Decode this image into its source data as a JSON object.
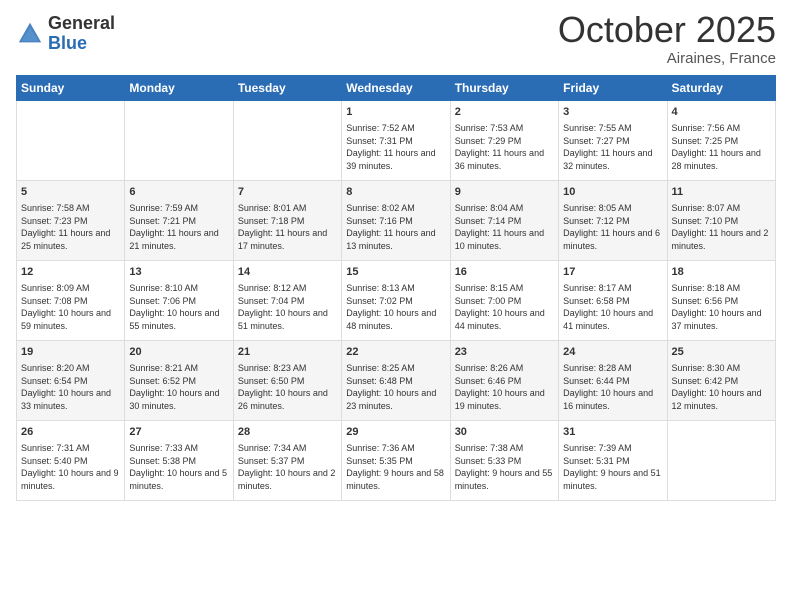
{
  "header": {
    "logo_general": "General",
    "logo_blue": "Blue",
    "month": "October 2025",
    "location": "Airaines, France"
  },
  "days_of_week": [
    "Sunday",
    "Monday",
    "Tuesday",
    "Wednesday",
    "Thursday",
    "Friday",
    "Saturday"
  ],
  "weeks": [
    [
      {
        "day": "",
        "info": ""
      },
      {
        "day": "",
        "info": ""
      },
      {
        "day": "",
        "info": ""
      },
      {
        "day": "1",
        "info": "Sunrise: 7:52 AM\nSunset: 7:31 PM\nDaylight: 11 hours and 39 minutes."
      },
      {
        "day": "2",
        "info": "Sunrise: 7:53 AM\nSunset: 7:29 PM\nDaylight: 11 hours and 36 minutes."
      },
      {
        "day": "3",
        "info": "Sunrise: 7:55 AM\nSunset: 7:27 PM\nDaylight: 11 hours and 32 minutes."
      },
      {
        "day": "4",
        "info": "Sunrise: 7:56 AM\nSunset: 7:25 PM\nDaylight: 11 hours and 28 minutes."
      }
    ],
    [
      {
        "day": "5",
        "info": "Sunrise: 7:58 AM\nSunset: 7:23 PM\nDaylight: 11 hours and 25 minutes."
      },
      {
        "day": "6",
        "info": "Sunrise: 7:59 AM\nSunset: 7:21 PM\nDaylight: 11 hours and 21 minutes."
      },
      {
        "day": "7",
        "info": "Sunrise: 8:01 AM\nSunset: 7:18 PM\nDaylight: 11 hours and 17 minutes."
      },
      {
        "day": "8",
        "info": "Sunrise: 8:02 AM\nSunset: 7:16 PM\nDaylight: 11 hours and 13 minutes."
      },
      {
        "day": "9",
        "info": "Sunrise: 8:04 AM\nSunset: 7:14 PM\nDaylight: 11 hours and 10 minutes."
      },
      {
        "day": "10",
        "info": "Sunrise: 8:05 AM\nSunset: 7:12 PM\nDaylight: 11 hours and 6 minutes."
      },
      {
        "day": "11",
        "info": "Sunrise: 8:07 AM\nSunset: 7:10 PM\nDaylight: 11 hours and 2 minutes."
      }
    ],
    [
      {
        "day": "12",
        "info": "Sunrise: 8:09 AM\nSunset: 7:08 PM\nDaylight: 10 hours and 59 minutes."
      },
      {
        "day": "13",
        "info": "Sunrise: 8:10 AM\nSunset: 7:06 PM\nDaylight: 10 hours and 55 minutes."
      },
      {
        "day": "14",
        "info": "Sunrise: 8:12 AM\nSunset: 7:04 PM\nDaylight: 10 hours and 51 minutes."
      },
      {
        "day": "15",
        "info": "Sunrise: 8:13 AM\nSunset: 7:02 PM\nDaylight: 10 hours and 48 minutes."
      },
      {
        "day": "16",
        "info": "Sunrise: 8:15 AM\nSunset: 7:00 PM\nDaylight: 10 hours and 44 minutes."
      },
      {
        "day": "17",
        "info": "Sunrise: 8:17 AM\nSunset: 6:58 PM\nDaylight: 10 hours and 41 minutes."
      },
      {
        "day": "18",
        "info": "Sunrise: 8:18 AM\nSunset: 6:56 PM\nDaylight: 10 hours and 37 minutes."
      }
    ],
    [
      {
        "day": "19",
        "info": "Sunrise: 8:20 AM\nSunset: 6:54 PM\nDaylight: 10 hours and 33 minutes."
      },
      {
        "day": "20",
        "info": "Sunrise: 8:21 AM\nSunset: 6:52 PM\nDaylight: 10 hours and 30 minutes."
      },
      {
        "day": "21",
        "info": "Sunrise: 8:23 AM\nSunset: 6:50 PM\nDaylight: 10 hours and 26 minutes."
      },
      {
        "day": "22",
        "info": "Sunrise: 8:25 AM\nSunset: 6:48 PM\nDaylight: 10 hours and 23 minutes."
      },
      {
        "day": "23",
        "info": "Sunrise: 8:26 AM\nSunset: 6:46 PM\nDaylight: 10 hours and 19 minutes."
      },
      {
        "day": "24",
        "info": "Sunrise: 8:28 AM\nSunset: 6:44 PM\nDaylight: 10 hours and 16 minutes."
      },
      {
        "day": "25",
        "info": "Sunrise: 8:30 AM\nSunset: 6:42 PM\nDaylight: 10 hours and 12 minutes."
      }
    ],
    [
      {
        "day": "26",
        "info": "Sunrise: 7:31 AM\nSunset: 5:40 PM\nDaylight: 10 hours and 9 minutes."
      },
      {
        "day": "27",
        "info": "Sunrise: 7:33 AM\nSunset: 5:38 PM\nDaylight: 10 hours and 5 minutes."
      },
      {
        "day": "28",
        "info": "Sunrise: 7:34 AM\nSunset: 5:37 PM\nDaylight: 10 hours and 2 minutes."
      },
      {
        "day": "29",
        "info": "Sunrise: 7:36 AM\nSunset: 5:35 PM\nDaylight: 9 hours and 58 minutes."
      },
      {
        "day": "30",
        "info": "Sunrise: 7:38 AM\nSunset: 5:33 PM\nDaylight: 9 hours and 55 minutes."
      },
      {
        "day": "31",
        "info": "Sunrise: 7:39 AM\nSunset: 5:31 PM\nDaylight: 9 hours and 51 minutes."
      },
      {
        "day": "",
        "info": ""
      }
    ]
  ]
}
